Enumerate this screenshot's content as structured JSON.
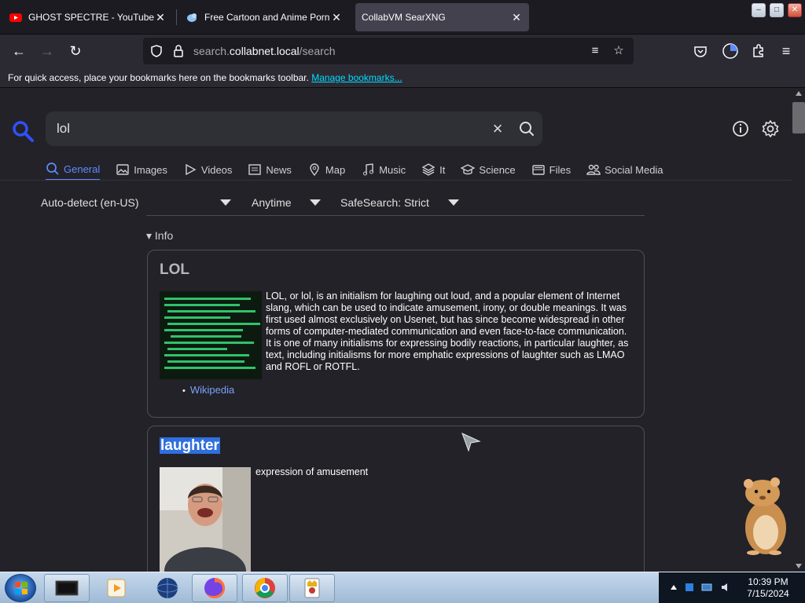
{
  "browser": {
    "tabs": [
      {
        "title": "GHOST SPECTRE - YouTube",
        "icon": "youtube-icon",
        "active": false
      },
      {
        "title": "Free Cartoon and Anime Porn -",
        "icon": "bird-icon",
        "active": false
      },
      {
        "title": "CollabVM SearXNG",
        "icon": "",
        "active": true
      }
    ],
    "close_glyph": "✕",
    "url": {
      "prefix": "search.",
      "host": "collabnet.local",
      "path": "/search"
    },
    "bookmarks_text": "For quick access, place your bookmarks here on the bookmarks toolbar.",
    "bookmarks_link": "Manage bookmarks..."
  },
  "search": {
    "query": "lol",
    "categories": [
      {
        "label": "General",
        "icon": "search-icon",
        "active": true
      },
      {
        "label": "Images",
        "icon": "image-icon",
        "active": false
      },
      {
        "label": "Videos",
        "icon": "play-icon",
        "active": false
      },
      {
        "label": "News",
        "icon": "newspaper-icon",
        "active": false
      },
      {
        "label": "Map",
        "icon": "map-pin-icon",
        "active": false
      },
      {
        "label": "Music",
        "icon": "music-icon",
        "active": false
      },
      {
        "label": "It",
        "icon": "layers-icon",
        "active": false
      },
      {
        "label": "Science",
        "icon": "school-icon",
        "active": false
      },
      {
        "label": "Files",
        "icon": "file-tray-icon",
        "active": false
      },
      {
        "label": "Social Media",
        "icon": "people-icon",
        "active": false
      }
    ],
    "filters": {
      "language": "Auto-detect (en-US)",
      "time": "Anytime",
      "safesearch": "SafeSearch: Strict"
    },
    "info_toggle": "▾ Info"
  },
  "infobox": [
    {
      "title": "LOL",
      "description": "LOL, or lol, is an initialism for laughing out loud, and a popular element of Internet slang, which can be used to indicate amusement, irony, or double meanings. It was first used almost exclusively on Usenet, but has since become widespread in other forms of computer-mediated communication and even face-to-face communication. It is one of many initialisms for expressing bodily reactions, in particular laughter, as text, including initialisms for more emphatic expressions of laughter such as LMAO and ROFL or ROTFL.",
      "source": "Wikipedia"
    },
    {
      "title": "laughter",
      "description": "expression of amusement"
    }
  ],
  "taskbar": {
    "time": "10:39 PM",
    "date": "7/15/2024"
  },
  "colors": {
    "accent": "#5d8cff",
    "link": "#7aa2f7",
    "highlight": "#2f6fde"
  }
}
